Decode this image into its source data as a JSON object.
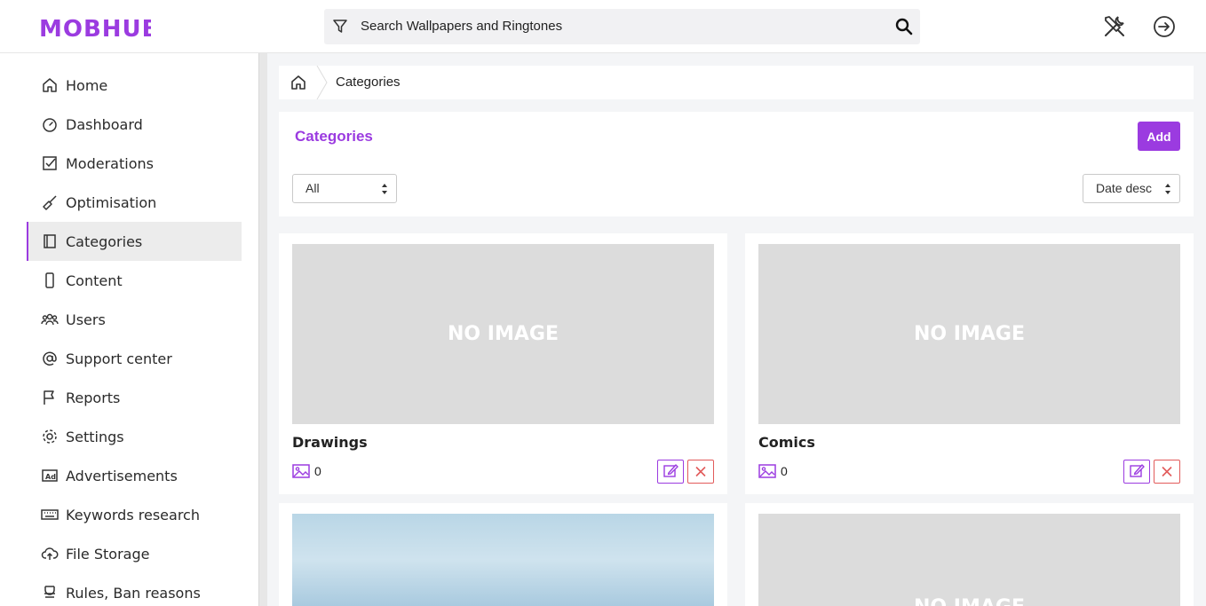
{
  "app": {
    "brand": "MOBHUB"
  },
  "search": {
    "placeholder": "Search Wallpapers and Ringtones"
  },
  "sidebar": {
    "items": [
      {
        "label": "Home",
        "icon": "home-icon"
      },
      {
        "label": "Dashboard",
        "icon": "gauge-icon"
      },
      {
        "label": "Moderations",
        "icon": "checkbox-icon"
      },
      {
        "label": "Optimisation",
        "icon": "broom-icon"
      },
      {
        "label": "Categories",
        "icon": "book-icon",
        "active": true
      },
      {
        "label": "Content",
        "icon": "phone-icon"
      },
      {
        "label": "Users",
        "icon": "users-icon"
      },
      {
        "label": "Support center",
        "icon": "at-icon"
      },
      {
        "label": "Reports",
        "icon": "flag-icon"
      },
      {
        "label": "Settings",
        "icon": "gear-icon"
      },
      {
        "label": "Advertisements",
        "icon": "ad-icon"
      },
      {
        "label": "Keywords research",
        "icon": "keyboard-icon"
      },
      {
        "label": "File Storage",
        "icon": "cloud-upload-icon"
      },
      {
        "label": "Rules, Ban reasons",
        "icon": "badge-icon"
      }
    ]
  },
  "breadcrumb": {
    "current": "Categories"
  },
  "panel": {
    "title": "Categories",
    "add_label": "Add",
    "filter_value": "All",
    "sort_value": "Date desc"
  },
  "cards": [
    {
      "name": "Drawings",
      "count": "0",
      "image_text": "NO IMAGE"
    },
    {
      "name": "Comics",
      "count": "0",
      "image_text": "NO IMAGE"
    },
    {
      "name": "",
      "count": "",
      "image_text": ""
    },
    {
      "name": "",
      "count": "",
      "image_text": "NO IMAGE"
    }
  ],
  "colors": {
    "accent": "#9b3be0",
    "danger": "#e25b5b"
  }
}
